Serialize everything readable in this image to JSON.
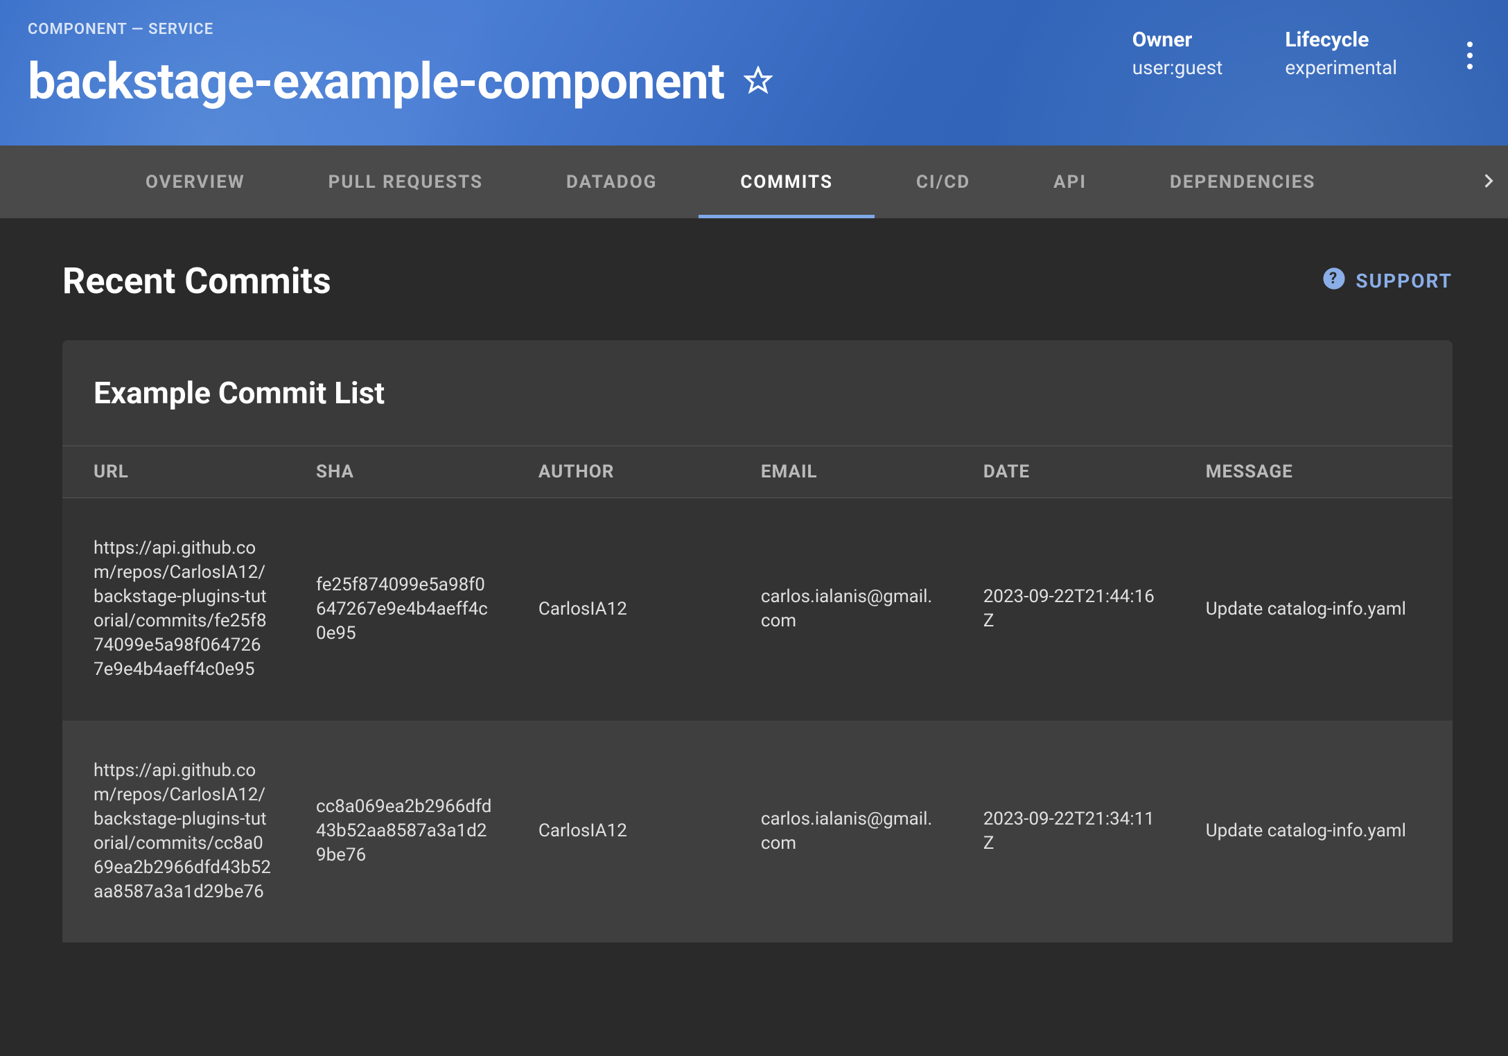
{
  "header": {
    "breadcrumb": "COMPONENT — SERVICE",
    "title": "backstage-example-component",
    "meta": {
      "owner_label": "Owner",
      "owner_value": "user:guest",
      "lifecycle_label": "Lifecycle",
      "lifecycle_value": "experimental"
    }
  },
  "tabs": [
    {
      "label": "OVERVIEW",
      "active": false
    },
    {
      "label": "PULL REQUESTS",
      "active": false
    },
    {
      "label": "DATADOG",
      "active": false
    },
    {
      "label": "COMMITS",
      "active": true
    },
    {
      "label": "CI/CD",
      "active": false
    },
    {
      "label": "API",
      "active": false
    },
    {
      "label": "DEPENDENCIES",
      "active": false
    }
  ],
  "content": {
    "section_title": "Recent Commits",
    "support_label": "SUPPORT",
    "card_title": "Example Commit List",
    "columns": [
      "URL",
      "SHA",
      "AUTHOR",
      "EMAIL",
      "DATE",
      "MESSAGE"
    ],
    "rows": [
      {
        "url": "https://api.github.com/repos/CarlosIA12/backstage-plugins-tutorial/commits/fe25f874099e5a98f0647267e9e4b4aeff4c0e95",
        "sha": "fe25f874099e5a98f0647267e9e4b4aeff4c0e95",
        "author": "CarlosIA12",
        "email": "carlos.ialanis@gmail.com",
        "date": "2023-09-22T21:44:16Z",
        "message": "Update catalog-info.yaml"
      },
      {
        "url": "https://api.github.com/repos/CarlosIA12/backstage-plugins-tutorial/commits/cc8a069ea2b2966dfd43b52aa8587a3a1d29be76",
        "sha": "cc8a069ea2b2966dfd43b52aa8587a3a1d29be76",
        "author": "CarlosIA12",
        "email": "carlos.ialanis@gmail.com",
        "date": "2023-09-22T21:34:11Z",
        "message": "Update catalog-info.yaml"
      }
    ]
  }
}
